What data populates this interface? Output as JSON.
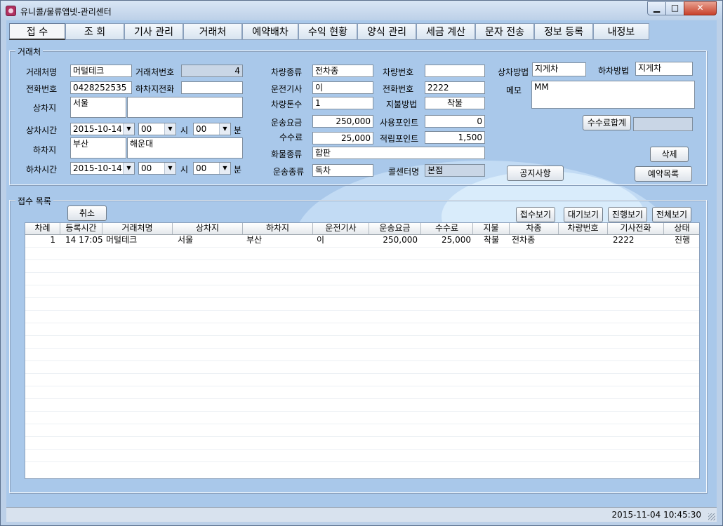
{
  "window": {
    "title": "유니콜/물류앱넷-관리센터"
  },
  "tabs": [
    "접 수",
    "조 회",
    "기사 관리",
    "거래처",
    "예약배차",
    "수익 현황",
    "양식 관리",
    "세금 계산",
    "문자 전송",
    "정보 등록",
    "내정보"
  ],
  "client_group": {
    "title": "거래처",
    "labels": {
      "client_name": "거래처명",
      "client_no": "거래처번호",
      "phone": "전화번호",
      "unload_phone": "하차지전화",
      "load_place": "상차지",
      "load_time": "상차시간",
      "unload_place": "하차지",
      "unload_time": "하차시간",
      "hour": "시",
      "minute": "분",
      "vehicle_type": "차량종류",
      "vehicle_no": "차량번호",
      "driver": "운전기사",
      "driver_phone": "전화번호",
      "tonnage": "차량톤수",
      "payment": "지불방법",
      "fare": "운송요금",
      "use_point": "사용포인트",
      "fee": "수수료",
      "earn_point": "적립포인트",
      "cargo": "화물종류",
      "transport_type": "운송종류",
      "call_center": "콜센터명",
      "load_method": "상차방법",
      "unload_method": "하차방법",
      "memo": "메모"
    },
    "values": {
      "client_name": "머털테크",
      "client_no": "4",
      "phone": "0428252535",
      "unload_phone": "",
      "load_place": "서울",
      "load_detail": "",
      "load_date": "2015-10-14",
      "load_hour": "00",
      "load_min": "00",
      "unload_place": "부산",
      "unload_detail": "해운대",
      "unload_date": "2015-10-14",
      "unload_hour": "00",
      "unload_min": "00",
      "vehicle_type": "전차종",
      "vehicle_no": "",
      "driver": "이",
      "driver_phone": "2222",
      "tonnage": "1",
      "payment": "착불",
      "fare": "250,000",
      "use_point": "0",
      "fee": "25,000",
      "earn_point": "1,500",
      "cargo": "합판",
      "transport_type": "독차",
      "call_center": "본점",
      "load_method": "지게차",
      "unload_method": "지게차",
      "memo": "MM",
      "fee_total": ""
    },
    "buttons": {
      "fee_total": "수수료합계",
      "delete": "삭제",
      "notice": "공지사항",
      "reservations": "예약목록"
    }
  },
  "list_group": {
    "title": "접수 목록",
    "buttons": {
      "cancel": "취소",
      "view_received": "접수보기",
      "view_waiting": "대기보기",
      "view_progress": "진행보기",
      "view_all": "전체보기"
    },
    "columns": [
      "차례",
      "등록시간",
      "거래처명",
      "상차지",
      "하차지",
      "운전기사",
      "운송요금",
      "수수료",
      "지불",
      "차종",
      "차량번호",
      "기사전화",
      "상태"
    ],
    "rows": [
      [
        "1",
        "14 17:05",
        "머털테크",
        "서울",
        "부산",
        "이",
        "250,000",
        "25,000",
        "착불",
        "전차종",
        "",
        "2222",
        "진행"
      ]
    ]
  },
  "status": {
    "datetime": "2015-11-04 10:45:30"
  }
}
